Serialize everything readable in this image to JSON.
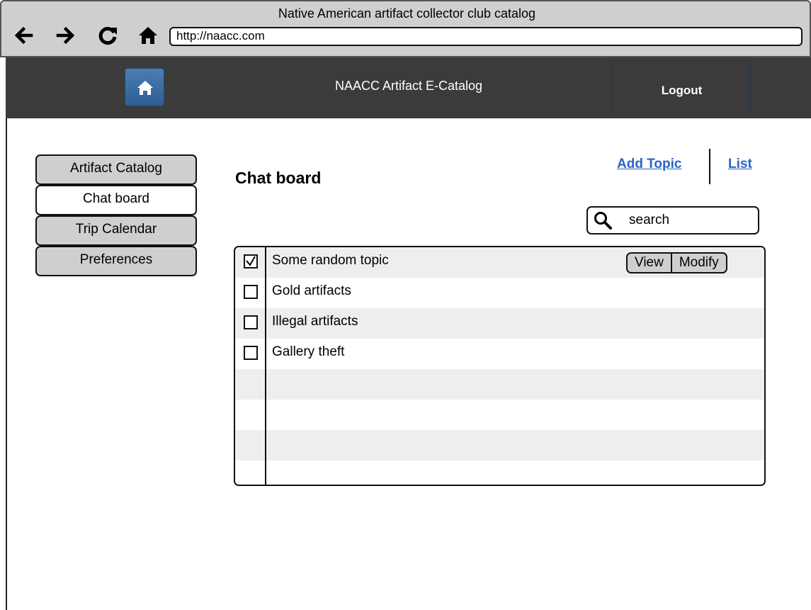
{
  "browser": {
    "window_title": "Native American artifact collector club catalog",
    "url": "http://naacc.com"
  },
  "header": {
    "title": "NAACC Artifact E-Catalog",
    "logout_label": "Logout"
  },
  "sidebar": {
    "items": [
      {
        "label": "Artifact Catalog",
        "active": false
      },
      {
        "label": "Chat board",
        "active": true
      },
      {
        "label": "Trip Calendar",
        "active": false
      },
      {
        "label": "Preferences",
        "active": false
      }
    ]
  },
  "main": {
    "title": "Chat board",
    "links": {
      "add_topic": "Add Topic",
      "list": "List"
    },
    "search": {
      "value": "search"
    },
    "row_actions": {
      "view": "View",
      "modify": "Modify"
    },
    "topics": [
      {
        "label": "Some random topic",
        "checked": true
      },
      {
        "label": "Gold artifacts",
        "checked": false
      },
      {
        "label": "Illegal artifacts",
        "checked": false
      },
      {
        "label": "Gallery theft",
        "checked": false
      }
    ]
  }
}
